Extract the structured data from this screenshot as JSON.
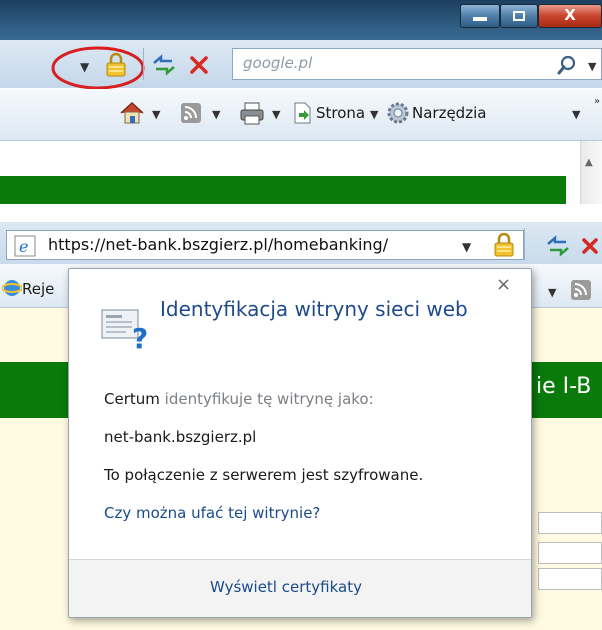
{
  "top": {
    "close_glyph": "X",
    "search_placeholder": "google.pl",
    "commands": {
      "page": "Strona",
      "tools": "Narzędzia"
    },
    "icons": [
      "dropdown-arrow-icon",
      "lock-icon",
      "refresh-icon",
      "stop-icon",
      "search-icon",
      "home-icon",
      "rss-feed-icon",
      "print-icon",
      "page-icon",
      "gear-icon"
    ],
    "highlight_color": "#d81f1f"
  },
  "bottom": {
    "url": "https://net-bank.bszgierz.pl/homebanking/",
    "tab_partial": "Reje",
    "page_heading_partial": "ie I-B",
    "popup": {
      "title": "Identyfikacja witryny sieci web",
      "close": "×",
      "issuer": "Certum",
      "identifies_text": "identyfikuje tę witrynę jako:",
      "domain": "net-bank.bszgierz.pl",
      "encrypted_text": "To połączenie z serwerem jest szyfrowane.",
      "trust_link": "Czy można ufać tej witrynie?",
      "view_certificates": "Wyświetl certyfikaty"
    }
  },
  "colors": {
    "green": "#0a7a0a",
    "link": "#1a4b8c",
    "title": "#1f4a8a",
    "page_bg": "#fffae1"
  }
}
